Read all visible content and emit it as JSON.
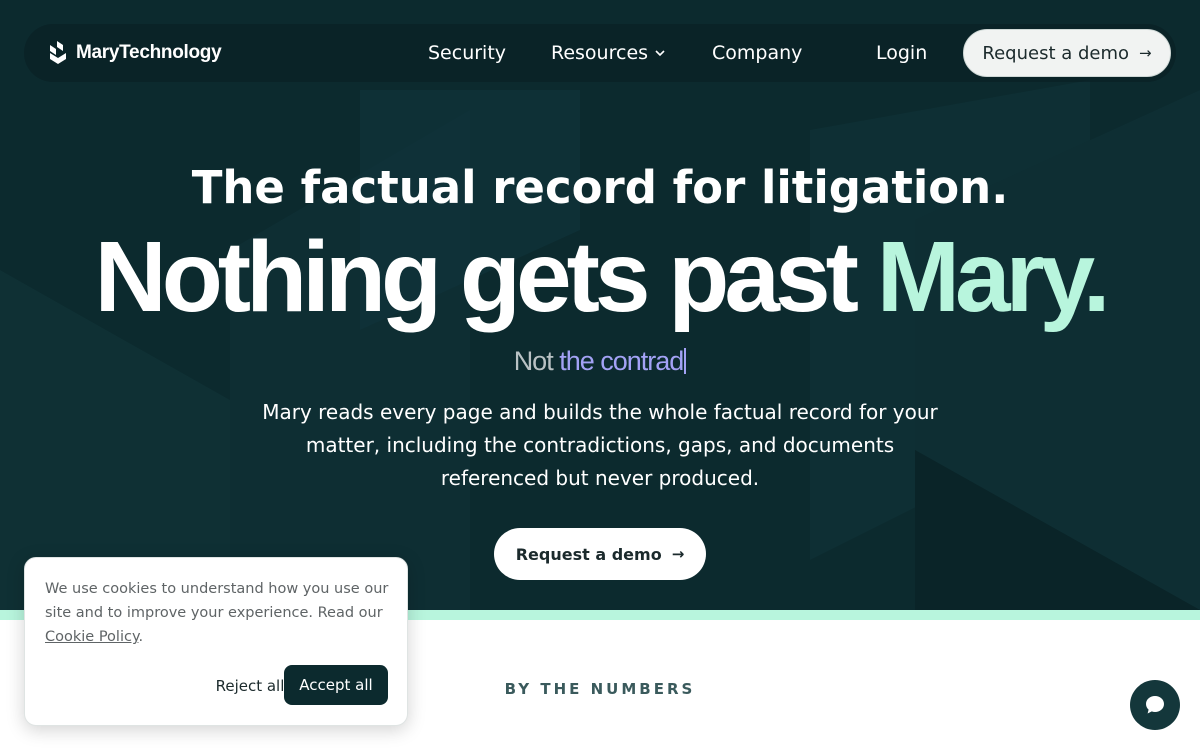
{
  "nav": {
    "brand": "MaryTechnology",
    "links": [
      "Security",
      "Resources",
      "Company"
    ],
    "login": "Login",
    "cta": "Request a demo"
  },
  "icons": {
    "logo": "mary-logo-icon",
    "dropdown": "chevron-down-icon",
    "arrow": "arrow-right-icon",
    "chat": "chat-bubble-icon"
  },
  "hero": {
    "tagline": "The factual record for litigation.",
    "headline_main": "Nothing gets past ",
    "headline_accent": "Mary.",
    "typing_static": "Not",
    "typing_dynamic": " the contrad",
    "description": "Mary reads every page and builds the whole factual record for your matter, including the contradictions, gaps, and documents referenced but never produced.",
    "cta": "Request a demo"
  },
  "section": {
    "label": "BY THE NUMBERS"
  },
  "cookie_banner": {
    "text": "We use cookies to understand how you use our site and to improve your experience. Read our ",
    "link": "Cookie Policy",
    "suffix": ".",
    "reject": "Reject all",
    "accept": "Accept all"
  },
  "colors": {
    "hero_background": "#0c2a2e",
    "accent_mint": "#b8f5dd",
    "typing_accent": "#a3a2f5",
    "button_dark": "#0c2a2e"
  }
}
